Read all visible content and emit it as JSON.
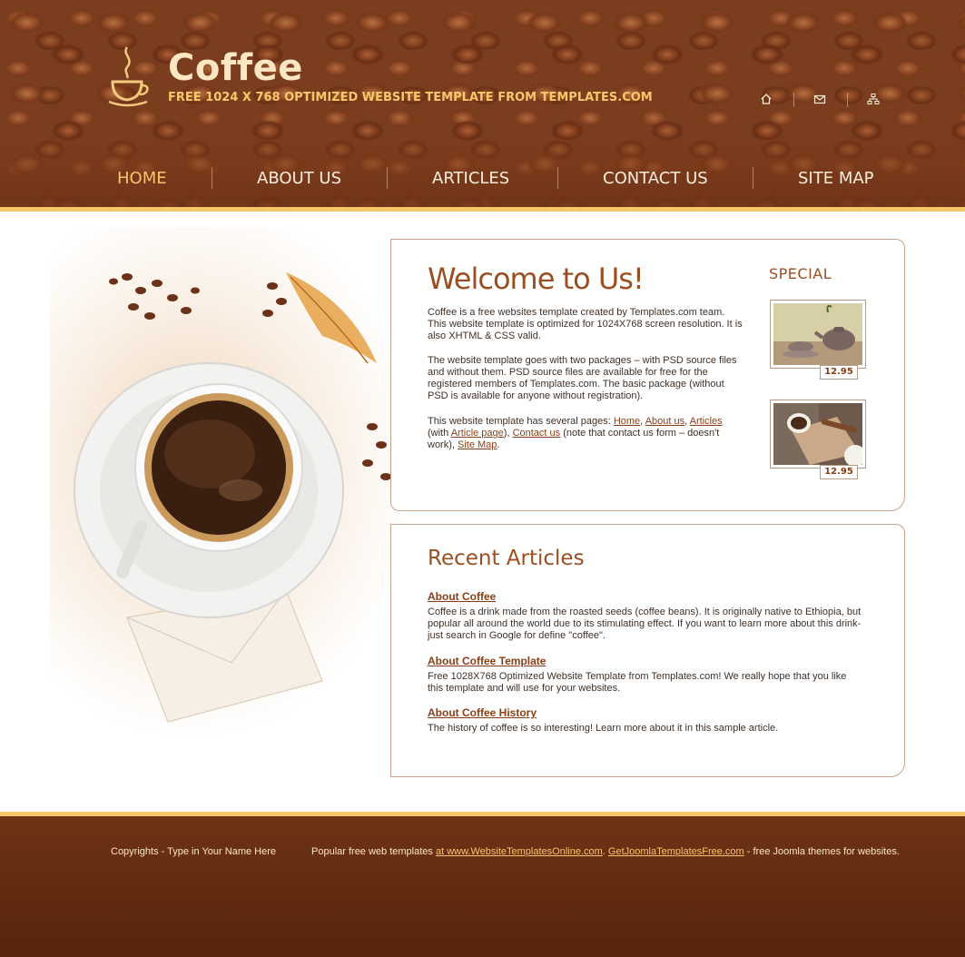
{
  "header": {
    "title": "Coffee",
    "subtitle": "FREE 1024 X 768 OPTIMIZED WEBSITE TEMPLATE FROM TEMPLATES.COM",
    "icons": [
      "home-icon",
      "mail-icon",
      "sitemap-icon"
    ]
  },
  "nav": {
    "items": [
      {
        "label": "HOME",
        "active": true
      },
      {
        "label": "ABOUT US",
        "active": false
      },
      {
        "label": "ARTICLES",
        "active": false
      },
      {
        "label": "CONTACT US",
        "active": false
      },
      {
        "label": "SITE MAP",
        "active": false
      }
    ]
  },
  "welcome": {
    "title": "Welcome to Us!",
    "p1": "Coffee is a free websites template created by Templates.com team. This website template is optimized for 1024X768 screen resolution. It is also XHTML & CSS valid.",
    "p2": "The website template goes with two packages – with PSD source files and without them. PSD source files are available for free for the registered members of Templates.com. The basic package (without PSD is available for anyone without registration).",
    "p3_intro": "This website template has several pages: ",
    "link_home": "Home",
    "link_about": "About us",
    "link_articles": "Articles",
    "p3_with": "(with ",
    "link_article_page": "Article page",
    "link_contact": "Contact us",
    "p3_note": " (note that contact us form – doesn't work), ",
    "link_sitemap": "Site Map",
    "comma": ", ",
    "close_paren_comma": "), ",
    "period": "."
  },
  "special": {
    "title": "SPECIAL",
    "items": [
      {
        "price": "12.95",
        "icon": "teapot-image"
      },
      {
        "price": "12.95",
        "icon": "coffee-cigar-image"
      }
    ]
  },
  "articles": {
    "title": "Recent Articles",
    "items": [
      {
        "title": "About Coffee",
        "body": "Coffee is a drink made from the roasted seeds (coffee beans). It is originally native to Ethiopia, but popular all around the world due to its stimulating effect. If you want to learn more about this drink- just search in Google for define \"coffee\"."
      },
      {
        "title": "About Coffee Template",
        "body": "Free 1028X768 Optimized Website Template from Templates.com! We really hope that you like this template and will use for your websites."
      },
      {
        "title": "About Coffee History",
        "body": "The history of coffee is so interesting! Learn more about it in this sample article."
      }
    ]
  },
  "footer": {
    "copyright": "Copyrights - Type in Your Name Here",
    "text_prefix": "Popular free web templates ",
    "link1": "at www.WebsiteTemplatesOnline.com",
    "sep": ". ",
    "link2": "GetJoomlaTemplatesFree.com",
    "text_suffix": " - free Joomla themes for websites."
  },
  "colors": {
    "accent": "#f5c66a",
    "brand_brown": "#9a4f22",
    "footer_bg": "#5f2a10"
  }
}
